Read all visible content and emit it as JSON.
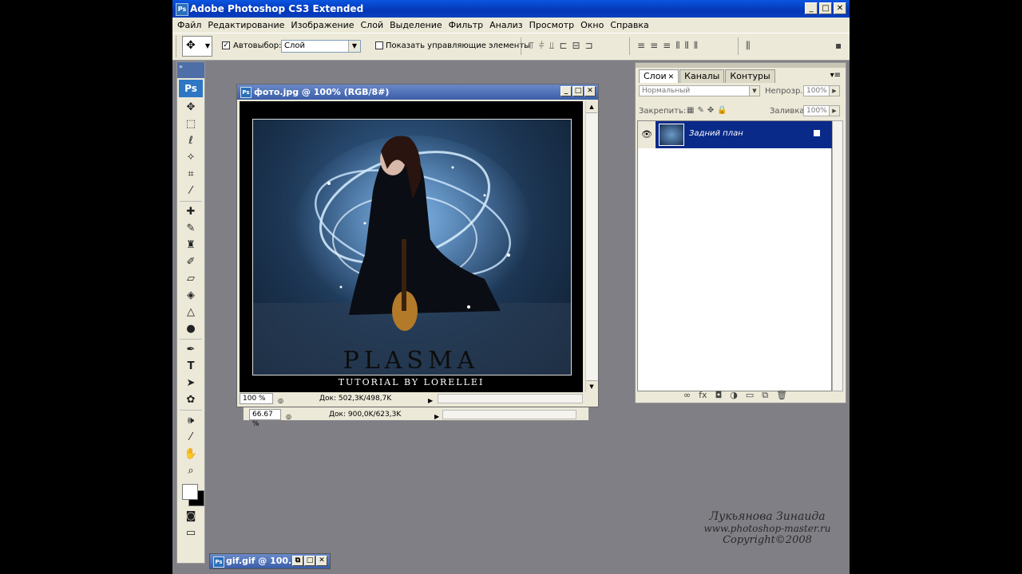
{
  "app": {
    "title": "Adobe Photoshop CS3 Extended",
    "icon_text": "Ps",
    "window_buttons": [
      "_",
      "□",
      "✕"
    ]
  },
  "menu": [
    "Файл",
    "Редактирование",
    "Изображение",
    "Слой",
    "Выделение",
    "Фильтр",
    "Анализ",
    "Просмотр",
    "Окно",
    "Справка"
  ],
  "options": {
    "auto_select_checked": true,
    "auto_select_label": "Автовыбор:",
    "auto_select_value": "Слой",
    "show_controls_checked": false,
    "show_controls_label": "Показать управляющие элементы"
  },
  "toolbox": {
    "logo": "Ps",
    "tools": [
      "move-icon",
      "marquee-icon",
      "lasso-icon",
      "magic-wand-icon",
      "crop-icon",
      "slice-icon",
      "healing-brush-icon",
      "brush-icon",
      "clone-stamp-icon",
      "history-brush-icon",
      "eraser-icon",
      "paint-bucket-icon",
      "blur-icon",
      "dodge-icon",
      "pen-icon",
      "type-icon",
      "path-selection-icon",
      "shape-icon",
      "notes-icon",
      "eyedropper-icon",
      "hand-icon",
      "zoom-icon"
    ],
    "type_tool_glyph": "T"
  },
  "doc_main": {
    "title": "фото.jpg @ 100% (RGB/8#)",
    "icon_text": "Ps",
    "zoom": "100 %",
    "info": "Док: 502,3K/498,7K",
    "photo_title": "PLASMA",
    "photo_subtitle": "TUTORIAL BY LORELLEI"
  },
  "doc_back": {
    "zoom": "66.67 %",
    "info": "Док: 900,0K/623,3K"
  },
  "doc_min": {
    "title": "gif.gif @ 100...",
    "icon_text": "Ps"
  },
  "layers_panel": {
    "tabs": [
      "Слои",
      "Каналы",
      "Контуры"
    ],
    "blend_mode": "Нормальный",
    "opacity_label": "Непрозр.:",
    "opacity_value": "100%",
    "lock_label": "Закрепить:",
    "fill_label": "Заливка:",
    "fill_value": "100%",
    "layers": [
      {
        "name": "Задний план",
        "visible": true,
        "selected": true,
        "locked": true
      }
    ]
  },
  "watermark": {
    "line1": "Лукьянова Зинаида",
    "line2": "www.photoshop-master.ru",
    "line3": "Copyright©2008"
  },
  "colors": {
    "foreground": "#ffffff",
    "background": "#000000",
    "titlebar": "#0537b8",
    "layer_selected": "#0a2a8a"
  }
}
